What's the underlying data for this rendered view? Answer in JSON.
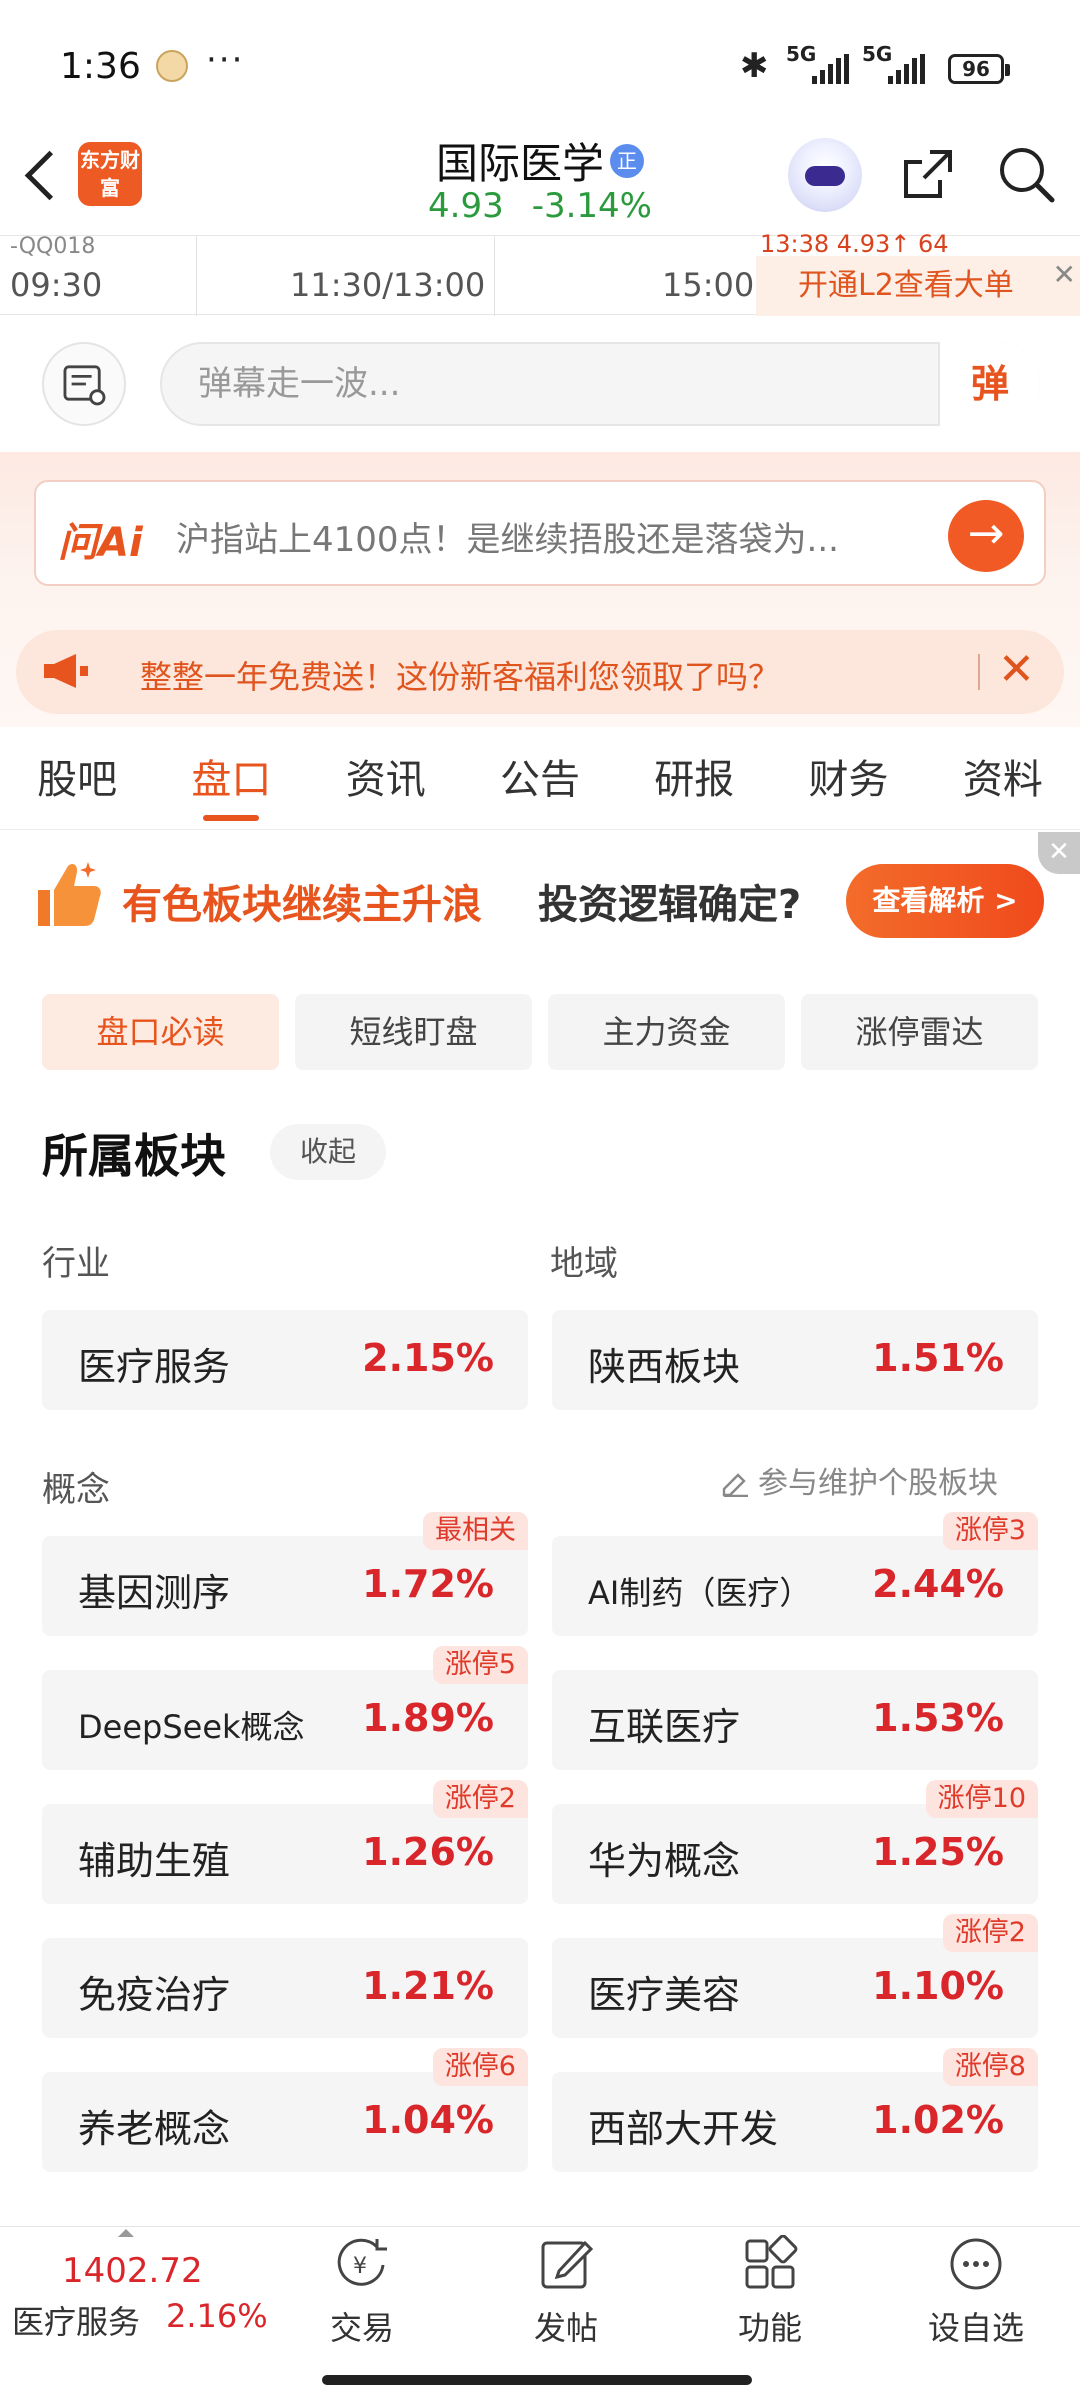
{
  "status_bar": {
    "time": "1:36",
    "signal1": "5G",
    "signal2": "5G",
    "battery": "96"
  },
  "header": {
    "logo_text": "东方财富",
    "stock_name": "国际医学",
    "stock_badge": "正",
    "price": "4.93",
    "change_pct": "-3.14%"
  },
  "chart": {
    "cut_text": "-QQ018",
    "top_right_text": "13:38    4.93↑   64",
    "times": [
      "09:30",
      "11:30/13:00",
      "15:00"
    ],
    "l2_text": "开通L2查看大单"
  },
  "danmu": {
    "placeholder": "弹幕走一波...",
    "send_label": "弹"
  },
  "ai": {
    "logo": "问Ai",
    "text": "沪指站上4100点！是继续捂股还是落袋为...",
    "go": "→"
  },
  "promo": {
    "text": "整整一年免费送！这份新客福利您领取了吗？",
    "close": "✕"
  },
  "tabs": [
    {
      "label": "股吧"
    },
    {
      "label": "盘口"
    },
    {
      "label": "资讯"
    },
    {
      "label": "公告"
    },
    {
      "label": "研报"
    },
    {
      "label": "财务"
    },
    {
      "label": "资料"
    }
  ],
  "sector_banner": {
    "highlight": "有色板块继续主升浪",
    "rest": "投资逻辑确定?",
    "button": "查看解析 >",
    "close": "✕"
  },
  "subtabs": [
    {
      "label": "盘口必读"
    },
    {
      "label": "短线盯盘"
    },
    {
      "label": "主力资金"
    },
    {
      "label": "涨停雷达"
    }
  ],
  "section": {
    "title": "所属板块",
    "collapse": "收起",
    "industry_label": "行业",
    "region_label": "地域",
    "concept_label": "概念",
    "maintain": "参与维护个股板块"
  },
  "industry": {
    "name": "医疗服务",
    "value": "2.15%"
  },
  "region": {
    "name": "陕西板块",
    "value": "1.51%"
  },
  "concepts": [
    {
      "name": "基因测序",
      "value": "1.72%",
      "tag": "最相关"
    },
    {
      "name": "AI制药（医疗）",
      "value": "2.44%",
      "tag": "涨停3"
    },
    {
      "name": "DeepSeek概念",
      "value": "1.89%",
      "tag": "涨停5"
    },
    {
      "name": "互联医疗",
      "value": "1.53%",
      "tag": ""
    },
    {
      "name": "辅助生殖",
      "value": "1.26%",
      "tag": "涨停2"
    },
    {
      "name": "华为概念",
      "value": "1.25%",
      "tag": "涨停10"
    },
    {
      "name": "免疫治疗",
      "value": "1.21%",
      "tag": ""
    },
    {
      "name": "医疗美容",
      "value": "1.10%",
      "tag": "涨停2"
    },
    {
      "name": "养老概念",
      "value": "1.04%",
      "tag": "涨停6"
    },
    {
      "name": "西部大开发",
      "value": "1.02%",
      "tag": "涨停8"
    }
  ],
  "bottom_bar": {
    "index_value": "1402.72",
    "index_name": "医疗服务",
    "index_pct": "2.16%",
    "nav": [
      {
        "label": "交易",
        "icon": "trade-icon"
      },
      {
        "label": "发帖",
        "icon": "post-icon"
      },
      {
        "label": "功能",
        "icon": "grid-icon"
      },
      {
        "label": "设自选",
        "icon": "more-icon"
      }
    ]
  },
  "colors": {
    "accent": "#e8541e",
    "up": "#d9262a",
    "down": "#2a9a3c"
  }
}
